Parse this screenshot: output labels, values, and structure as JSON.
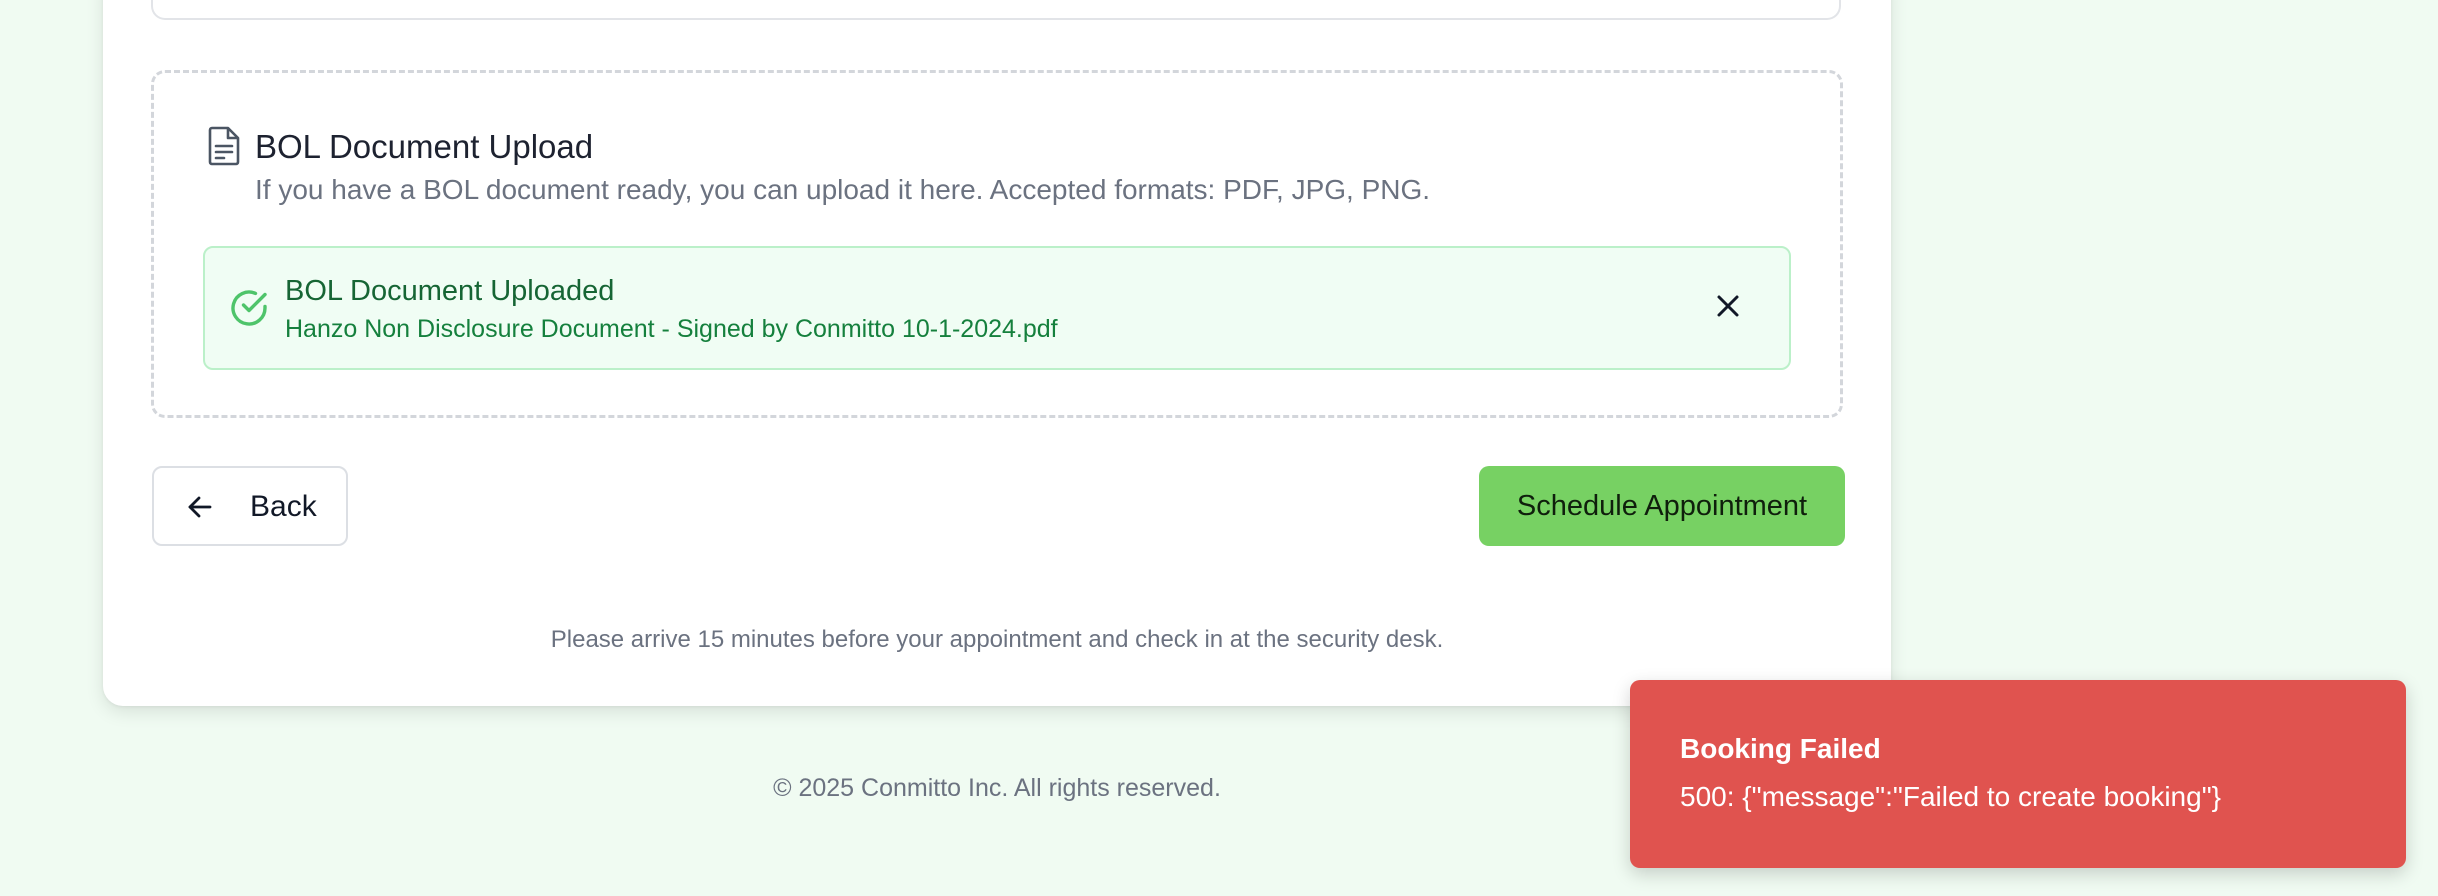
{
  "upload": {
    "title": "BOL Document Upload",
    "description": "If you have a BOL document ready, you can upload it here. Accepted formats: PDF, JPG, PNG.",
    "icon": "document-icon",
    "uploaded": {
      "title": "BOL Document Uploaded",
      "filename": "Hanzo Non Disclosure Document - Signed by Conmitto 10-1-2024.pdf",
      "status_icon": "check-circle-icon",
      "remove_icon": "close-icon"
    }
  },
  "actions": {
    "back_label": "Back",
    "back_icon": "arrow-left-icon",
    "submit_label": "Schedule Appointment"
  },
  "note": "Please arrive 15 minutes before your appointment and check in at the security desk.",
  "footer": "© 2025 Conmitto Inc. All rights reserved.",
  "toast": {
    "title": "Booking Failed",
    "message": "500: {\"message\":\"Failed to create booking\"}"
  },
  "colors": {
    "page_background": "#f0fbf2",
    "accent_green": "#77d163",
    "success_text": "#166534",
    "error_toast": "#e0534f"
  }
}
